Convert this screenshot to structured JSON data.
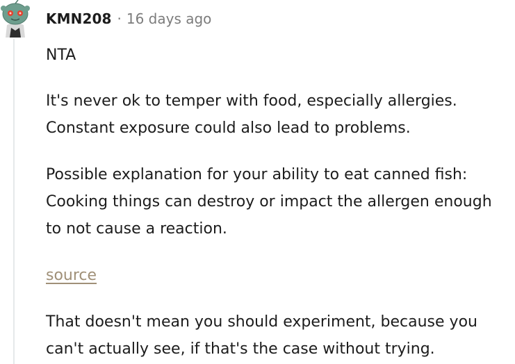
{
  "comment": {
    "username": "KMN208",
    "separator": "·",
    "timestamp": "16 days ago",
    "paragraphs": [
      "NTA",
      "It's never ok to temper with food, especially allergies. Constant exposure could also lead to problems.",
      "Possible explanation for your ability to eat canned fish: Cooking things can destroy or impact the allergen enough to not cause a reaction."
    ],
    "link_text": "source",
    "closing": "That doesn't mean you should experiment, because you can't actually see, if that's the case without trying."
  },
  "colors": {
    "avatar_head": "#6e9e8e",
    "avatar_eyes": "#e5412e",
    "link": "#a09078",
    "meta": "#7c7c7c"
  },
  "icons": {
    "avatar": "snoo-avatar-icon"
  }
}
